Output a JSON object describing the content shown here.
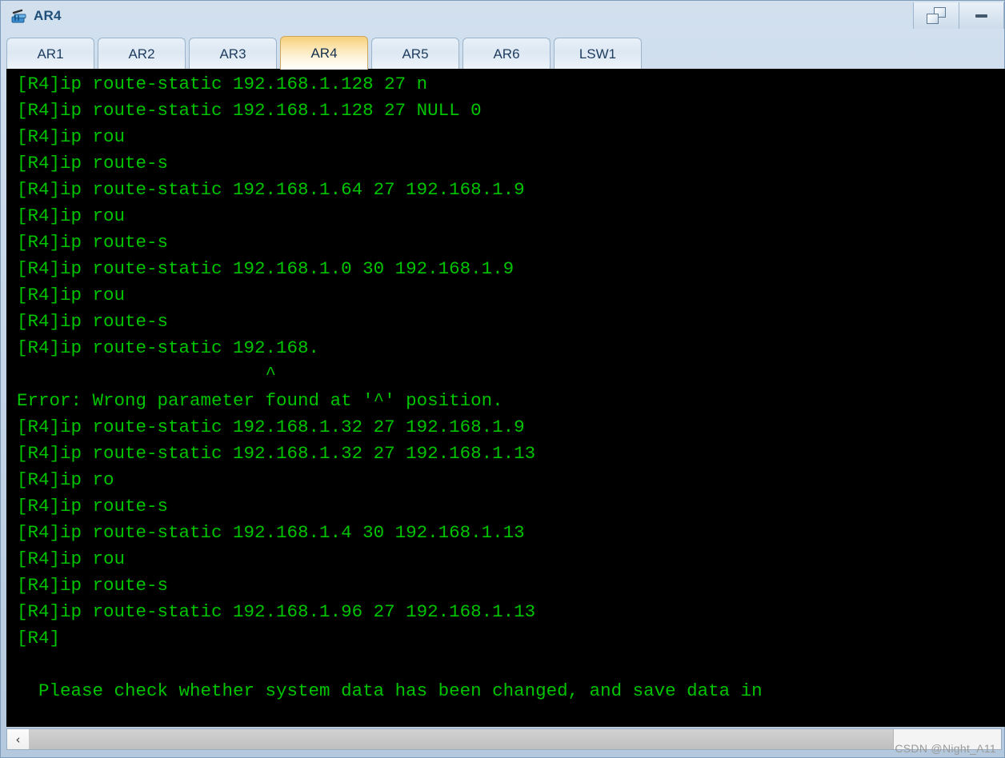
{
  "window": {
    "title": "AR4",
    "icon": "router-icon",
    "controls": [
      {
        "name": "restore-button",
        "icon": "restore-icon",
        "label": ""
      },
      {
        "name": "minimize-button",
        "icon": "minimize-icon",
        "label": ""
      }
    ]
  },
  "tabs": {
    "items": [
      {
        "label": "AR1",
        "active": false
      },
      {
        "label": "AR2",
        "active": false
      },
      {
        "label": "AR3",
        "active": false
      },
      {
        "label": "AR4",
        "active": true
      },
      {
        "label": "AR5",
        "active": false
      },
      {
        "label": "AR6",
        "active": false
      },
      {
        "label": "LSW1",
        "active": false
      }
    ]
  },
  "terminal": {
    "foreground_color": "#00c400",
    "background_color": "#000000",
    "lines": [
      "[R4]ip route-static 192.168.1.128 27 n",
      "[R4]ip route-static 192.168.1.128 27 NULL 0",
      "[R4]ip rou",
      "[R4]ip route-s",
      "[R4]ip route-static 192.168.1.64 27 192.168.1.9",
      "[R4]ip rou",
      "[R4]ip route-s",
      "[R4]ip route-static 192.168.1.0 30 192.168.1.9",
      "[R4]ip rou",
      "[R4]ip route-s",
      "[R4]ip route-static 192.168.",
      "                       ^",
      "Error: Wrong parameter found at '^' position.",
      "[R4]ip route-static 192.168.1.32 27 192.168.1.9",
      "[R4]ip route-static 192.168.1.32 27 192.168.1.13",
      "[R4]ip ro",
      "[R4]ip route-s",
      "[R4]ip route-static 192.168.1.4 30 192.168.1.13",
      "[R4]ip rou",
      "[R4]ip route-s",
      "[R4]ip route-static 192.168.1.96 27 192.168.1.13",
      "[R4]",
      "",
      "  Please check whether system data has been changed, and save data in"
    ]
  },
  "scrollbar": {
    "left_arrow_glyph": "‹",
    "orientation": "horizontal"
  },
  "watermark": {
    "text": "CSDN @Night_A11"
  }
}
